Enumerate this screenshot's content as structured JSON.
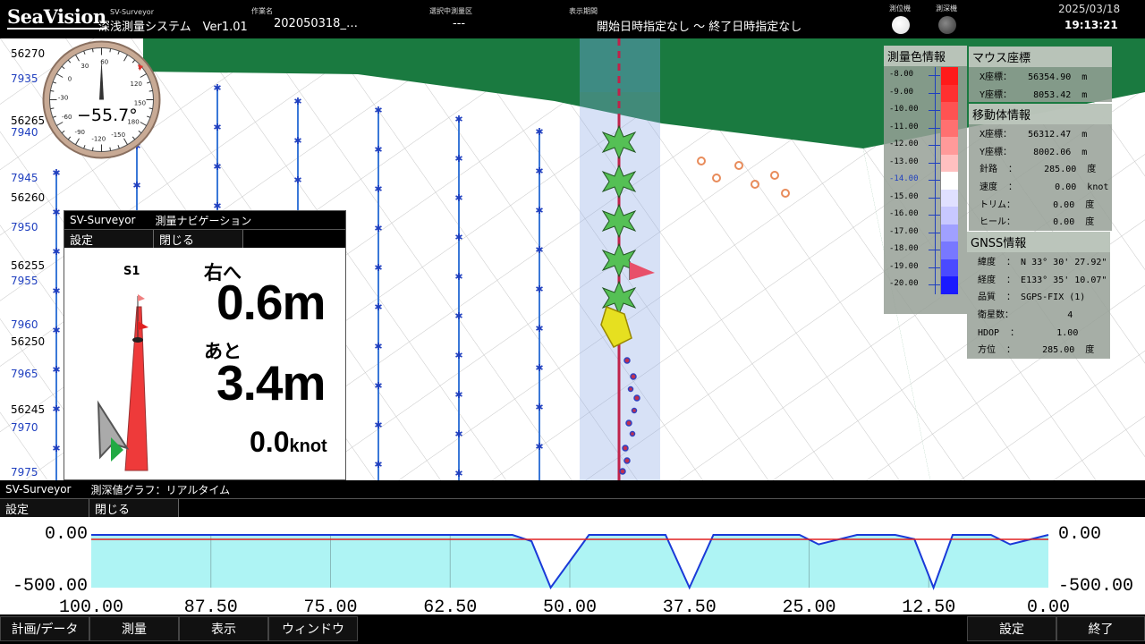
{
  "topbar": {
    "logo": "SeaVision",
    "app_small": "SV-Surveyor",
    "app_title": "深浅測量システム　Ver1.01",
    "work_label": "作業名",
    "work_name": "202050318_…",
    "area_label": "選択中測量区",
    "area_value": "---",
    "period_label": "表示期間",
    "period_value": "開始日時指定なし 〜 終了日時指定なし",
    "gnss_label": "測位機",
    "sounder_label": "測深機",
    "date": "2025/03/18",
    "time": "19:13:21"
  },
  "map": {
    "y_labels": [
      "56270",
      "56265",
      "56260",
      "56255",
      "56250",
      "56245"
    ],
    "x_labels": [
      "7935",
      "7940",
      "7945",
      "7950",
      "7955",
      "7960",
      "7965",
      "7970",
      "7975"
    ],
    "compass_value": "−55.7°",
    "compass_ticks": [
      "-30",
      "-60",
      "-90",
      "-120",
      "-150",
      "180",
      "150",
      "120",
      "0",
      "60",
      "30"
    ],
    "line_label": "S1"
  },
  "nav_window": {
    "title_app": "SV-Surveyor",
    "title": "測量ナビゲーション",
    "menu_settings": "設定",
    "menu_close": "閉じる",
    "line_name": "S1",
    "direction_label": "右へ",
    "offset_value": "0.6m",
    "remain_label": "あと",
    "remain_value": "3.4m",
    "speed_value": "0.0",
    "speed_unit": "knot"
  },
  "depth_legend": {
    "title": "測量色情報",
    "values": [
      "-8.00",
      "-9.00",
      "-10.00",
      "-11.00",
      "-12.00",
      "-13.00",
      "-14.00",
      "-15.00",
      "-16.00",
      "-17.00",
      "-18.00",
      "-19.00",
      "-20.00"
    ],
    "colors": [
      "#ff1a1a",
      "#ff3030",
      "#ff5252",
      "#ff7070",
      "#ff9a9a",
      "#ffc0c0",
      "#ffffff",
      "#e0e0ff",
      "#c8c8ff",
      "#a0a0ff",
      "#7878ff",
      "#4a4aff",
      "#1a1aff"
    ],
    "highlight_index": 6
  },
  "mouse_panel": {
    "title": "マウス座標",
    "x_row": "X座標：   56354.90  m",
    "y_row": "Y座標：    8053.42  m"
  },
  "vessel_panel": {
    "title": "移動体情報",
    "rows": [
      "X座標：   56312.47  m",
      "Y座標：    8002.06  m",
      "針路  ：     285.00  度",
      "速度  ：       0.00  knot",
      "トリム：       0.00  度",
      "ヒール：       0.00  度"
    ]
  },
  "gnss_panel": {
    "title": "GNSS情報",
    "rows": [
      "緯度  ： N 33° 30' 27.92\"",
      "経度  ： E133° 35' 10.07\"",
      "品質  ： SGPS-FIX (1)",
      "衛星数：          4",
      "HDOP  ：       1.00",
      "方位  ：     285.00  度"
    ]
  },
  "graph_window": {
    "title_app": "SV-Surveyor",
    "title": "測深値グラフ：リアルタイム",
    "menu_settings": "設定",
    "menu_close": "閉じる",
    "y_top": "0.00",
    "y_bottom": "-500.00",
    "x_labels": [
      "100.00",
      "87.50",
      "75.00",
      "62.50",
      "50.00",
      "37.50",
      "25.00",
      "12.50",
      "0.00"
    ]
  },
  "chart_data": {
    "type": "area",
    "x": [
      100,
      80,
      60,
      56,
      54,
      52,
      48,
      40,
      37.5,
      35,
      26,
      24,
      20,
      16,
      14,
      12,
      10,
      6,
      4,
      0
    ],
    "series": [
      {
        "values": [
          0,
          0,
          0,
          0,
          -60,
          -500,
          0,
          0,
          -500,
          0,
          0,
          -90,
          0,
          0,
          -40,
          -500,
          0,
          0,
          -90,
          0
        ]
      }
    ],
    "xlim": [
      100,
      0
    ],
    "ylim": [
      -500,
      0
    ],
    "grid": true
  },
  "bottombar": {
    "plan": "計画/データ",
    "survey": "測量",
    "view": "表示",
    "window": "ウィンドウ",
    "settings": "設定",
    "exit": "終了"
  }
}
